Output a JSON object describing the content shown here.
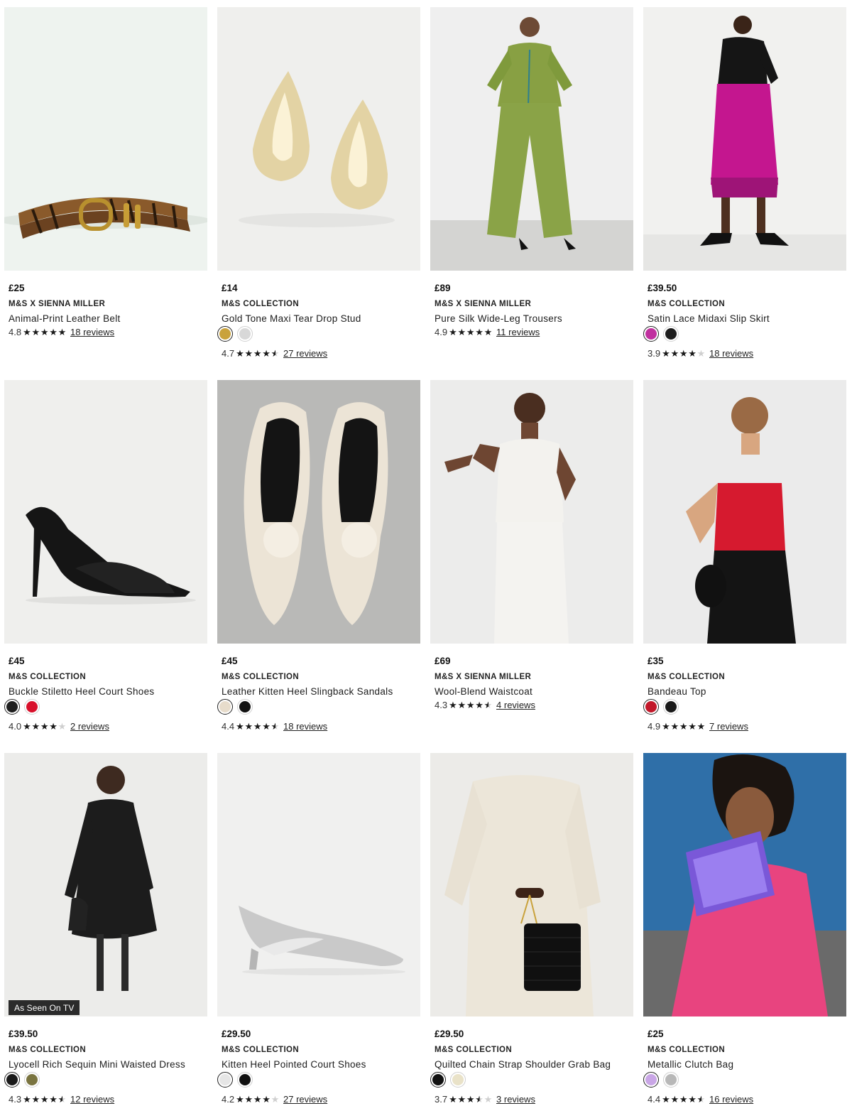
{
  "products": [
    {
      "price": "£25",
      "brand": "M&S X SIENNA MILLER",
      "name": "Animal-Print Leather Belt",
      "rating": "4.8",
      "stars": 4.8,
      "reviews": "18 reviews",
      "swatches": [],
      "image": "animal-print-belt"
    },
    {
      "price": "£14",
      "brand": "M&S COLLECTION",
      "name": "Gold Tone Maxi Tear Drop Stud",
      "rating": "4.7",
      "stars": 4.7,
      "reviews": "27 reviews",
      "swatches": [
        {
          "color": "#c9a23c",
          "selected": true
        },
        {
          "color": "#d8d8d8",
          "selected": false
        }
      ],
      "image": "gold-earrings"
    },
    {
      "price": "£89",
      "brand": "M&S X SIENNA MILLER",
      "name": "Pure Silk Wide-Leg Trousers",
      "rating": "4.9",
      "stars": 4.9,
      "reviews": "11 reviews",
      "swatches": [],
      "image": "green-silk-set"
    },
    {
      "price": "£39.50",
      "brand": "M&S COLLECTION",
      "name": "Satin Lace Midaxi Slip Skirt",
      "rating": "3.9",
      "stars": 3.9,
      "reviews": "18 reviews",
      "swatches": [
        {
          "color": "#c0309f",
          "selected": true
        },
        {
          "color": "#1e1e1e",
          "selected": false
        }
      ],
      "image": "magenta-skirt"
    },
    {
      "price": "£45",
      "brand": "M&S COLLECTION",
      "name": "Buckle Stiletto Heel Court Shoes",
      "rating": "4.0",
      "stars": 4.0,
      "reviews": "2 reviews",
      "swatches": [
        {
          "color": "#1e1e1e",
          "selected": true
        },
        {
          "color": "#d8102b",
          "selected": false
        }
      ],
      "image": "black-stiletto"
    },
    {
      "price": "£45",
      "brand": "M&S COLLECTION",
      "name": "Leather Kitten Heel Slingback Sandals",
      "rating": "4.4",
      "stars": 4.4,
      "reviews": "18 reviews",
      "swatches": [
        {
          "color": "#e7dccb",
          "selected": true
        },
        {
          "color": "#111111",
          "selected": false
        }
      ],
      "image": "cream-slingbacks"
    },
    {
      "price": "£69",
      "brand": "M&S X SIENNA MILLER",
      "name": "Wool-Blend Waistcoat",
      "rating": "4.3",
      "stars": 4.3,
      "reviews": "4 reviews",
      "swatches": [],
      "image": "white-waistcoat"
    },
    {
      "price": "£35",
      "brand": "M&S COLLECTION",
      "name": "Bandeau Top",
      "rating": "4.9",
      "stars": 4.9,
      "reviews": "7 reviews",
      "swatches": [
        {
          "color": "#c2182a",
          "selected": true
        },
        {
          "color": "#1a1a1a",
          "selected": false
        }
      ],
      "image": "red-bandeau"
    },
    {
      "price": "£39.50",
      "brand": "M&S COLLECTION",
      "name": "Lyocell Rich Sequin Mini Waisted Dress",
      "rating": "4.3",
      "stars": 4.3,
      "reviews": "12 reviews",
      "swatches": [
        {
          "color": "#1a1a1a",
          "selected": true
        },
        {
          "color": "#7a7440",
          "selected": false
        }
      ],
      "badge": "As Seen On TV",
      "image": "black-dress"
    },
    {
      "price": "£29.50",
      "brand": "M&S COLLECTION",
      "name": "Kitten Heel Pointed Court Shoes",
      "rating": "4.2",
      "stars": 4.2,
      "reviews": "27 reviews",
      "swatches": [
        {
          "color": "#e6e6e6",
          "selected": true
        },
        {
          "color": "#111111",
          "selected": false
        }
      ],
      "image": "silver-kitten-heel"
    },
    {
      "price": "£29.50",
      "brand": "M&S COLLECTION",
      "name": "Quilted Chain Strap Shoulder Grab Bag",
      "rating": "3.7",
      "stars": 3.7,
      "reviews": "3 reviews",
      "swatches": [
        {
          "color": "#111111",
          "selected": true
        },
        {
          "color": "#e9e2c8",
          "selected": false
        }
      ],
      "image": "black-quilted-bag"
    },
    {
      "price": "£25",
      "brand": "M&S COLLECTION",
      "name": "Metallic Clutch Bag",
      "rating": "4.4",
      "stars": 4.4,
      "reviews": "16 reviews",
      "swatches": [
        {
          "color": "#c9a6e6",
          "selected": true
        },
        {
          "color": "#b8b8b8",
          "selected": false
        }
      ],
      "image": "metallic-clutch"
    }
  ]
}
